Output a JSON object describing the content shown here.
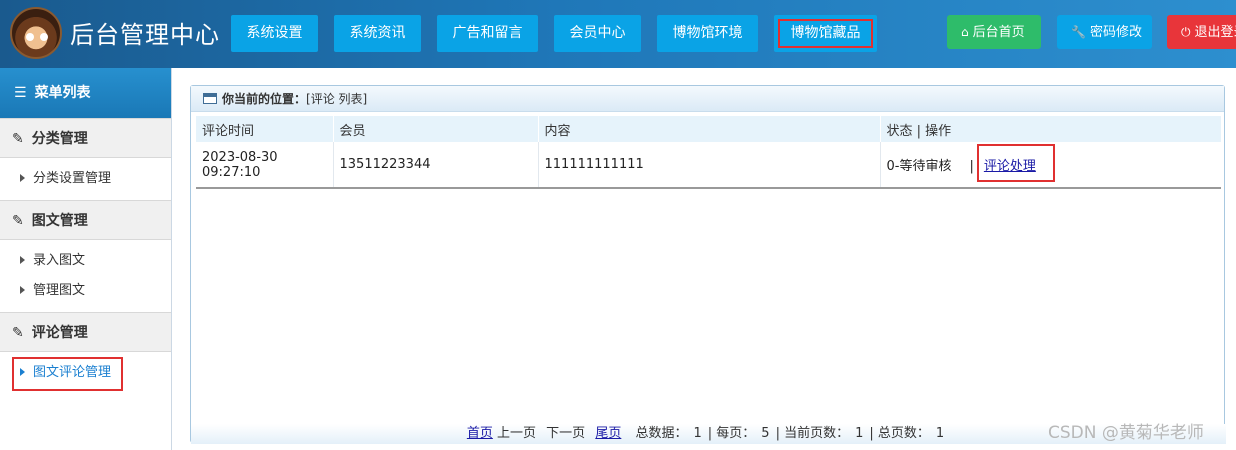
{
  "header": {
    "title": "后台管理中心",
    "nav": [
      {
        "label": "系统设置",
        "highlight": false
      },
      {
        "label": "系统资讯",
        "highlight": false
      },
      {
        "label": "广告和留言",
        "highlight": false
      },
      {
        "label": "会员中心",
        "highlight": false
      },
      {
        "label": "博物馆环境",
        "highlight": false
      },
      {
        "label": "博物馆藏品",
        "highlight": true
      }
    ],
    "actions": [
      {
        "label": "后台首页",
        "icon": "home-icon",
        "color": "#2ebc6a"
      },
      {
        "label": "密码修改",
        "icon": "wrench-icon",
        "color": "#0aa3e6"
      },
      {
        "label": "退出登录",
        "icon": "power-icon",
        "color": "#e8353a"
      }
    ]
  },
  "sidebar": {
    "title": "菜单列表",
    "sections": [
      {
        "title": "分类管理",
        "items": [
          {
            "label": "分类设置管理",
            "active": false
          }
        ]
      },
      {
        "title": "图文管理",
        "items": [
          {
            "label": "录入图文",
            "active": false
          },
          {
            "label": "管理图文",
            "active": false
          }
        ]
      },
      {
        "title": "评论管理",
        "items": [
          {
            "label": "图文评论管理",
            "active": true
          }
        ]
      }
    ]
  },
  "main": {
    "location_label": "你当前的位置：",
    "location_value": "[评论 列表]",
    "columns": [
      "评论时间",
      "会员",
      "内容",
      "状态 | 操作"
    ],
    "rows": [
      {
        "time_date": "2023-08-30",
        "time_clock": "09:27:10",
        "member": "13511223344",
        "content": "111111111111",
        "status": "0-等待审核",
        "separator": "|",
        "action": "评论处理"
      }
    ],
    "pager": {
      "first": "首页",
      "prev": "上一页",
      "next": "下一页",
      "last": "尾页",
      "total_label": "总数据：",
      "total": "1",
      "per_page_label": "| 每页：",
      "per_page": "5",
      "current_label": "| 当前页数：",
      "current": "1",
      "pages_label": "| 总页数：",
      "pages": "1"
    }
  },
  "watermark": "CSDN @黄菊华老师",
  "colors": {
    "accent": "#0aa3e6",
    "highlight_box": "#e03030"
  }
}
